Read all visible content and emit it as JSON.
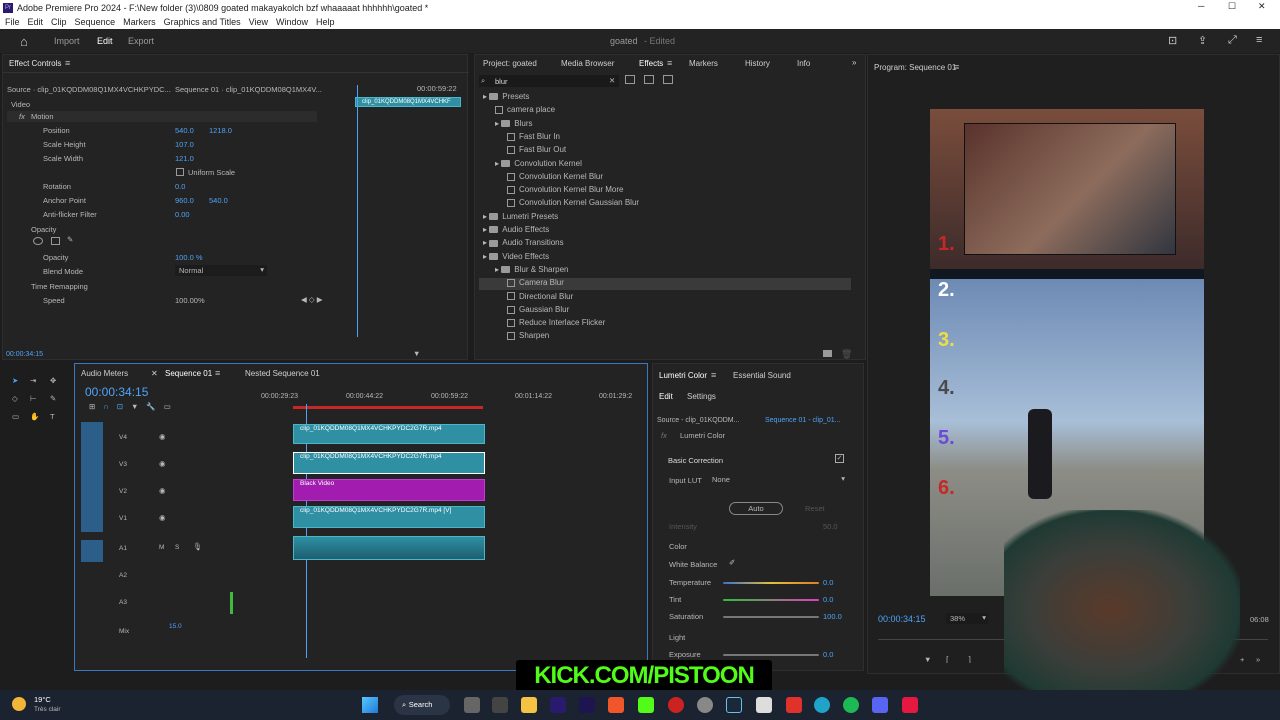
{
  "window": {
    "title": "Adobe Premiere Pro 2024 - F:\\New folder (3)\\0809 goated makayakolch bzf whaaaaat hhhhhh\\goated *"
  },
  "menu": [
    "File",
    "Edit",
    "Clip",
    "Sequence",
    "Markers",
    "Graphics and Titles",
    "View",
    "Window",
    "Help"
  ],
  "app": {
    "tabs": [
      "Import",
      "Edit",
      "Export"
    ],
    "project_name": "goated",
    "project_status": "- Edited"
  },
  "effect_controls": {
    "title": "Effect Controls",
    "source": "Source · clip_01KQDDM08Q1MX4VCHKPYDC...",
    "sequence": "Sequence 01 · clip_01KQDDM08Q1MX4V...",
    "timecode_top": "00:00:59:22",
    "clip_label": "clip_01KQDDM08Q1MX4VCHKF",
    "video_label": "Video",
    "motion_label": "Motion",
    "params": [
      {
        "name": "Position",
        "v1": "540.0",
        "v2": "1218.0"
      },
      {
        "name": "Scale Height",
        "v1": "107.0",
        "v2": ""
      },
      {
        "name": "Scale Width",
        "v1": "121.0",
        "v2": ""
      },
      {
        "name": "Rotation",
        "v1": "0.0",
        "v2": ""
      },
      {
        "name": "Anchor Point",
        "v1": "960.0",
        "v2": "540.0"
      },
      {
        "name": "Anti-flicker Filter",
        "v1": "0.00",
        "v2": ""
      }
    ],
    "uniform_scale": "Uniform Scale",
    "opacity_label": "Opacity",
    "opacity_param": "Opacity",
    "opacity_value": "100.0 %",
    "blend_mode_label": "Blend Mode",
    "blend_mode_value": "Normal",
    "time_remap_label": "Time Remapping",
    "speed_label": "Speed",
    "speed_value": "100.00%",
    "bottom_timecode": "00:00:34:15"
  },
  "project_tabs": [
    "Project: goated",
    "Media Browser",
    "Effects",
    "Markers",
    "History",
    "Info"
  ],
  "effects": {
    "search_value": "blur",
    "tree": [
      {
        "label": "Presets",
        "level": 0,
        "kind": "folder"
      },
      {
        "label": "camera place",
        "level": 1,
        "kind": "fx"
      },
      {
        "label": "Blurs",
        "level": 1,
        "kind": "folder"
      },
      {
        "label": "Fast Blur In",
        "level": 2,
        "kind": "fx"
      },
      {
        "label": "Fast Blur Out",
        "level": 2,
        "kind": "fx"
      },
      {
        "label": "Convolution Kernel",
        "level": 1,
        "kind": "folder"
      },
      {
        "label": "Convolution Kernel Blur",
        "level": 2,
        "kind": "fx"
      },
      {
        "label": "Convolution Kernel Blur More",
        "level": 2,
        "kind": "fx"
      },
      {
        "label": "Convolution Kernel Gaussian Blur",
        "level": 2,
        "kind": "fx"
      },
      {
        "label": "Lumetri Presets",
        "level": 0,
        "kind": "folder"
      },
      {
        "label": "Audio Effects",
        "level": 0,
        "kind": "folder"
      },
      {
        "label": "Audio Transitions",
        "level": 0,
        "kind": "folder"
      },
      {
        "label": "Video Effects",
        "level": 0,
        "kind": "folder"
      },
      {
        "label": "Blur & Sharpen",
        "level": 1,
        "kind": "folder"
      },
      {
        "label": "Camera Blur",
        "level": 2,
        "kind": "fx"
      },
      {
        "label": "Directional Blur",
        "level": 2,
        "kind": "fx"
      },
      {
        "label": "Gaussian Blur",
        "level": 2,
        "kind": "fx"
      },
      {
        "label": "Reduce Interlace Flicker",
        "level": 2,
        "kind": "fx"
      },
      {
        "label": "Sharpen",
        "level": 2,
        "kind": "fx"
      }
    ]
  },
  "program": {
    "title": "Program: Sequence 01",
    "timecode": "00:00:34:15",
    "zoom": "38%",
    "end_time": "06:08",
    "overlay_numbers": [
      "1.",
      "2.",
      "3.",
      "4.",
      "5.",
      "6."
    ]
  },
  "timeline": {
    "tabs": [
      "Audio Meters",
      "Sequence 01",
      "Nested Sequence 01"
    ],
    "timecode": "00:00:34:15",
    "ruler": [
      "00:00:29:23",
      "00:00:44:22",
      "00:00:59:22",
      "00:01:14:22",
      "00:01:29:2"
    ],
    "video_tracks": [
      {
        "name": "V4",
        "clip": "clip_01KQDDM08Q1MX4VCHKPYDC2G7R.mp4"
      },
      {
        "name": "V3",
        "clip": "clip_01KQDDM08Q1MX4VCHKPYDC2G7R.mp4"
      },
      {
        "name": "V2",
        "clip": "Black Video"
      },
      {
        "name": "V1",
        "clip": "clip_01KQDDM08Q1MX4VCHKPYDC2G7R.mp4 [V]"
      }
    ],
    "audio_tracks": [
      "A1",
      "A2",
      "A3"
    ],
    "mix_label": "Mix",
    "mix_value": "15.0",
    "track_buttons": [
      "M",
      "S"
    ]
  },
  "lumetri": {
    "tabs": [
      "Lumetri Color",
      "Essential Sound"
    ],
    "subtabs": [
      "Edit",
      "Settings"
    ],
    "source": "Source - clip_01KQDDM...",
    "sequence": "Sequence 01 - clip_01...",
    "effect": "Lumetri Color",
    "basic_correction": "Basic Correction",
    "input_lut_label": "Input LUT",
    "input_lut_value": "None",
    "auto": "Auto",
    "reset": "Reset",
    "intensity_label": "Intensity",
    "intensity_value": "50.0",
    "color_label": "Color",
    "white_balance": "White Balance",
    "temperature_label": "Temperature",
    "temperature_value": "0.0",
    "tint_label": "Tint",
    "tint_value": "0.0",
    "saturation_label": "Saturation",
    "saturation_value": "100.0",
    "light_label": "Light",
    "exposure_label": "Exposure",
    "exposure_value": "0.0"
  },
  "overlay": {
    "kick": "KICK.COM/PISTOON"
  },
  "taskbar": {
    "weather_temp": "19°C",
    "weather_desc": "Très clair",
    "search": "Search"
  },
  "colors": {
    "accent": "#4fa3f7",
    "clip": "#2f8fa3",
    "black_video": "#a21caf",
    "panel": "#232323",
    "kick": "#53fc18"
  }
}
